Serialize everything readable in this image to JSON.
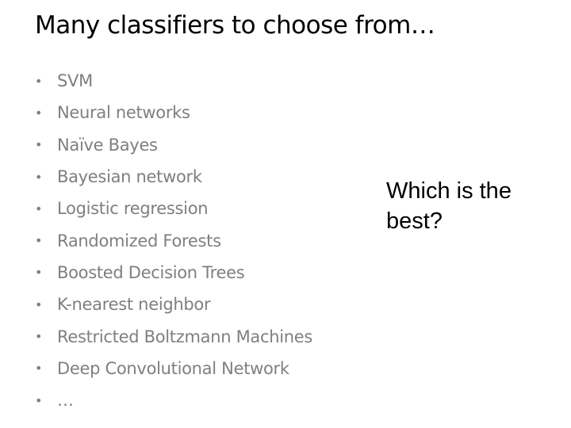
{
  "slide": {
    "title": "Many classifiers to choose from…",
    "bullets": [
      "SVM",
      "Neural networks",
      "Naïve Bayes",
      "Bayesian network",
      "Logistic regression",
      "Randomized Forests",
      "Boosted Decision Trees",
      "K-nearest neighbor",
      "Restricted Boltzmann Machines",
      "Deep Convolutional Network",
      "…"
    ],
    "bullet_glyph": "•",
    "side_text": "Which is the best?"
  }
}
